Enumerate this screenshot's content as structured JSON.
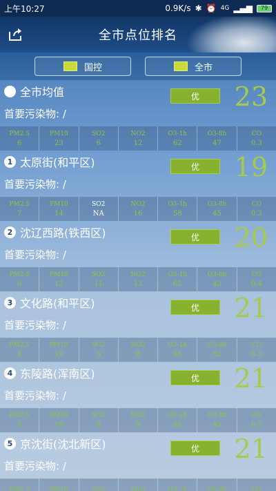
{
  "status": {
    "time": "上午10:27",
    "speed": "0.9K/s",
    "network": "4G",
    "battery": "79"
  },
  "header": {
    "title": "全市点位排名"
  },
  "tabs": [
    {
      "label": "国控"
    },
    {
      "label": "全市"
    }
  ],
  "metric_labels": [
    "PM2.5",
    "PM10",
    "SO2",
    "NO2",
    "O3-1h",
    "O3-8h",
    "CO"
  ],
  "stations": [
    {
      "rank": "",
      "name": "全市均值",
      "pollutant_label": "首要污染物:",
      "pollutant_value": "/",
      "grade": "优",
      "aqi": "23",
      "metrics": [
        "6",
        "23",
        "6",
        "12",
        "62",
        "47",
        "0.3"
      ]
    },
    {
      "rank": "1",
      "name": "太原街(和平区)",
      "pollutant_label": "首要污染物:",
      "pollutant_value": "/",
      "grade": "优",
      "aqi": "19",
      "metrics": [
        "7",
        "14",
        "NA",
        "16",
        "58",
        "45",
        "0.3"
      ]
    },
    {
      "rank": "2",
      "name": "沈辽西路(铁西区)",
      "pollutant_label": "首要污染物:",
      "pollutant_value": "/",
      "grade": "优",
      "aqi": "20",
      "metrics": [
        "6",
        "12",
        "11",
        "13",
        "62",
        "43",
        "0.4"
      ]
    },
    {
      "rank": "3",
      "name": "文化路(和平区)",
      "pollutant_label": "首要污染物:",
      "pollutant_value": "/",
      "grade": "优",
      "aqi": "21",
      "metrics": [
        "4",
        "19",
        "3",
        "8",
        "66",
        "52",
        "0.3"
      ]
    },
    {
      "rank": "4",
      "name": "东陵路(浑南区)",
      "pollutant_label": "首要污染物:",
      "pollutant_value": "/",
      "grade": "优",
      "aqi": "21",
      "metrics": [
        "5",
        "19",
        "8",
        "9",
        "65",
        "45",
        "0.5"
      ]
    },
    {
      "rank": "5",
      "name": "京沈街(沈北新区)",
      "pollutant_label": "首要污染物:",
      "pollutant_value": "/",
      "grade": "优",
      "aqi": "21",
      "metrics": [
        "",
        "",
        "",
        "",
        "",
        "",
        ""
      ]
    }
  ],
  "colors": {
    "accent_green": "#8dc63f",
    "grade_bg": "#86b230",
    "aqi_color": "#a7c94c"
  }
}
